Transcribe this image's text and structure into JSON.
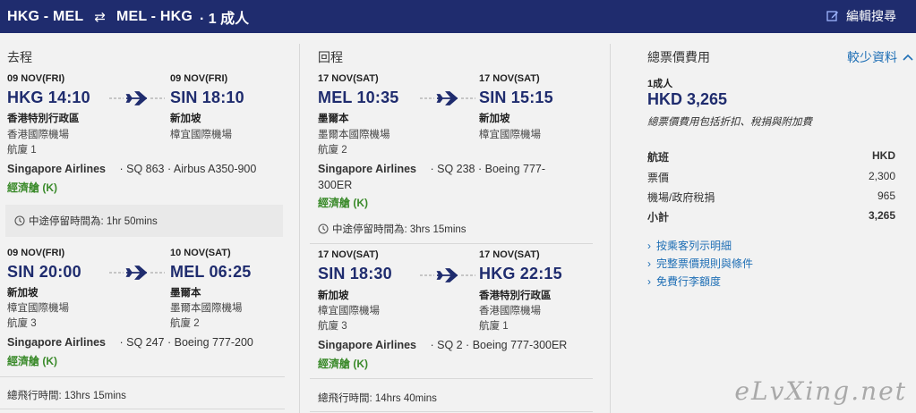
{
  "header": {
    "outbound_route": "HKG - MEL",
    "swap_icon": "⇄",
    "return_route": "MEL - HKG",
    "passengers": "· 1 成人",
    "edit_label": "編輯搜尋"
  },
  "outbound": {
    "title": "去程",
    "segments": [
      {
        "dep_date": "09 NOV(FRI)",
        "dep_time": "HKG 14:10",
        "dep_city": "香港特別行政區",
        "dep_airport": "香港國際機場",
        "dep_terminal": "航廈 1",
        "arr_date": "09 NOV(FRI)",
        "arr_time": "SIN 18:10",
        "arr_city": "新加坡",
        "arr_airport": "樟宜國際機場",
        "airline": "Singapore Airlines",
        "flight": "· SQ 863 · Airbus A350-900",
        "cabin": "經濟艙 (K)"
      },
      {
        "dep_date": "09 NOV(FRI)",
        "dep_time": "SIN 20:00",
        "dep_city": "新加坡",
        "dep_airport": "樟宜國際機場",
        "dep_terminal": "航廈 3",
        "arr_date": "10 NOV(SAT)",
        "arr_time": "MEL 06:25",
        "arr_city": "墨爾本",
        "arr_airport": "墨爾本國際機場",
        "arr_terminal": "航廈 2",
        "airline": "Singapore Airlines",
        "flight": "· SQ 247 · Boeing 777-200",
        "cabin": "經濟艙 (K)"
      }
    ],
    "layover": "中途停留時間為:  1hr 50mins",
    "total": "總飛行時間:   13hrs 15mins"
  },
  "inbound": {
    "title": "回程",
    "segments": [
      {
        "dep_date": "17 NOV(SAT)",
        "dep_time": "MEL 10:35",
        "dep_city": "墨爾本",
        "dep_airport": "墨爾本國際機場",
        "dep_terminal": "航廈 2",
        "arr_date": "17 NOV(SAT)",
        "arr_time": "SIN 15:15",
        "arr_city": "新加坡",
        "arr_airport": "樟宜國際機場",
        "airline": "Singapore Airlines",
        "flight": "· SQ 238 · Boeing 777-",
        "flight_cont": "300ER",
        "cabin": "經濟艙 (K)"
      },
      {
        "dep_date": "17 NOV(SAT)",
        "dep_time": "SIN 18:30",
        "dep_city": "新加坡",
        "dep_airport": "樟宜國際機場",
        "dep_terminal": "航廈 3",
        "arr_date": "17 NOV(SAT)",
        "arr_time": "HKG 22:15",
        "arr_city": "香港特別行政區",
        "arr_airport": "香港國際機場",
        "arr_terminal": "航廈 1",
        "airline": "Singapore Airlines",
        "flight": "· SQ 2 · Boeing 777-300ER",
        "cabin": "經濟艙 (K)"
      }
    ],
    "layover": "中途停留時間為:  3hrs 15mins",
    "total": "總飛行時間:   14hrs 40mins"
  },
  "price": {
    "title": "總票價費用",
    "toggle_label": "較少資料",
    "pax": "1成人",
    "total": "HKD 3,265",
    "note": "總票價費用包括折扣、稅捐與附加費",
    "header_left": "航班",
    "header_right": "HKD",
    "rows": [
      {
        "label": "票價",
        "value": "2,300"
      },
      {
        "label": "機場/政府稅捐",
        "value": "965"
      },
      {
        "label": "小計",
        "value": "3,265"
      }
    ],
    "links": [
      "按乘客列示明細",
      "完整票價規則與條件",
      "免費行李額度"
    ]
  },
  "watermark": "eLvXing.net",
  "colors": {
    "header_bg": "#1f2c6e",
    "accent_blue": "#1f6fb5",
    "cabin_green": "#3a8a2a"
  }
}
